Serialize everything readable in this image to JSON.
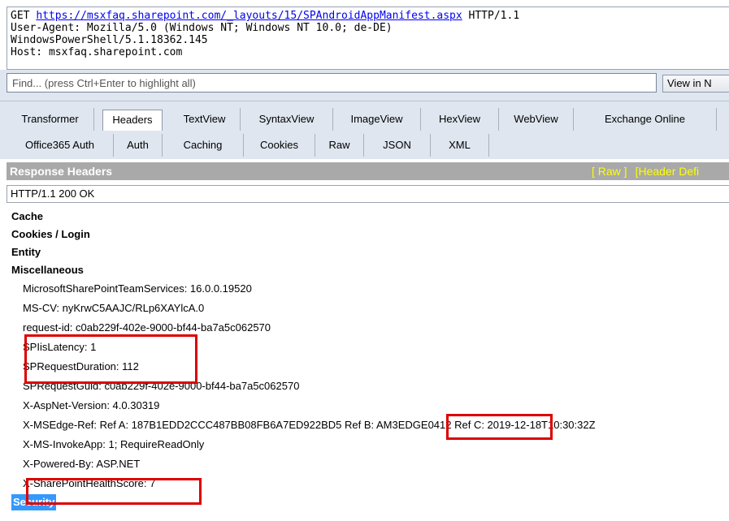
{
  "request": {
    "method": "GET",
    "url": "https://msxfaq.sharepoint.com/_layouts/15/SPAndroidAppManifest.aspx",
    "protocol": "HTTP/1.1",
    "lines": [
      "User-Agent: Mozilla/5.0 (Windows NT; Windows NT 10.0; de-DE)",
      "WindowsPowerShell/5.1.18362.145",
      "Host: msxfaq.sharepoint.com"
    ]
  },
  "find": {
    "placeholder": "Find... (press Ctrl+Enter to highlight all)",
    "view_button": "View in N"
  },
  "tabs": {
    "row1": [
      "Transformer",
      "Headers",
      "TextView",
      "SyntaxView",
      "ImageView",
      "HexView",
      "WebView",
      "Exchange Online"
    ],
    "row2": [
      "Office365 Auth",
      "Auth",
      "Caching",
      "Cookies",
      "Raw",
      "JSON",
      "XML"
    ],
    "selected": "Headers"
  },
  "response": {
    "title": "Response Headers",
    "links": [
      "[ Raw ]",
      "[Header Defi"
    ],
    "status_line": "HTTP/1.1 200 OK",
    "categories": [
      "Cache",
      "Cookies / Login",
      "Entity",
      "Miscellaneous"
    ],
    "misc_items": [
      "MicrosoftSharePointTeamServices: 16.0.0.19520",
      "MS-CV: nyKrwC5AAJC/RLp6XAYlcA.0",
      "request-id: c0ab229f-402e-9000-bf44-ba7a5c062570",
      "SPIisLatency: 1",
      "SPRequestDuration: 112",
      "SPRequestGuid: c0ab229f-402e-9000-bf44-ba7a5c062570",
      "X-AspNet-Version: 4.0.30319",
      "X-MSEdge-Ref: Ref A: 187B1EDD2CCC487BB08FB6A7ED922BD5 Ref B: AM3EDGE0412 Ref C: 2019-12-18T10:30:32Z",
      "X-MS-InvokeApp: 1; RequireReadOnly",
      "X-Powered-By: ASP.NET",
      "X-SharePointHealthScore: 7"
    ],
    "last_category": "Security"
  },
  "colors": {
    "highlight": "#dd0000",
    "selection": "#3399ff",
    "header_bar": "#a9a9a9",
    "link_yellow": "#ffff00"
  }
}
